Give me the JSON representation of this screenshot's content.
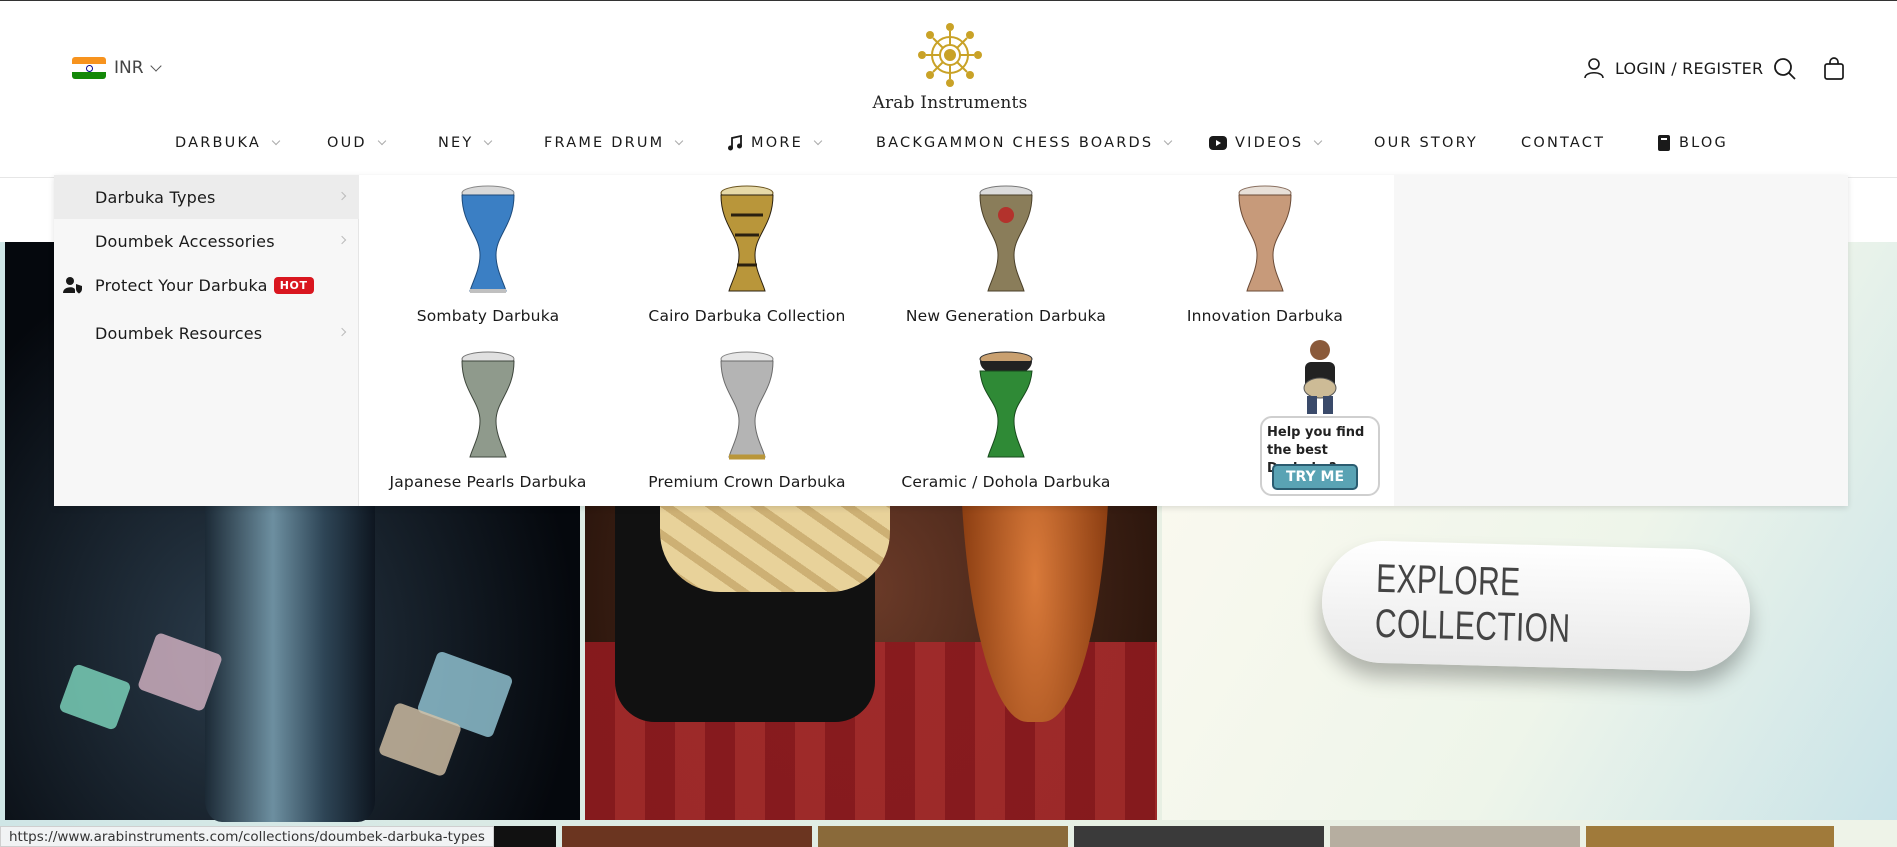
{
  "header": {
    "currency": {
      "code": "INR",
      "flag_icon": "india-flag-icon"
    },
    "logo": {
      "text": "Arab Instruments",
      "color": "#c9a227"
    },
    "account": {
      "label": "LOGIN / REGISTER",
      "icon": "user-icon"
    },
    "search_icon": "search-icon",
    "cart_icon": "shopping-bag-icon"
  },
  "nav": {
    "items": [
      {
        "label": "DARBUKA",
        "has_dropdown": true
      },
      {
        "label": "OUD",
        "has_dropdown": true
      },
      {
        "label": "NEY",
        "has_dropdown": true
      },
      {
        "label": "FRAME DRUM",
        "has_dropdown": true
      },
      {
        "label": "MORE",
        "has_dropdown": true,
        "icon": "music-note-icon"
      },
      {
        "label": "BACKGAMMON CHESS BOARDS",
        "has_dropdown": true
      },
      {
        "label": "VIDEOS",
        "has_dropdown": true,
        "icon": "youtube-icon"
      },
      {
        "label": "OUR STORY",
        "has_dropdown": false
      },
      {
        "label": "CONTACT",
        "has_dropdown": false
      },
      {
        "label": "BLOG",
        "has_dropdown": false,
        "icon": "book-icon"
      }
    ]
  },
  "mega_menu": {
    "side_items": [
      {
        "label": "Darbuka Types",
        "active": true
      },
      {
        "label": "Doumbek Accessories"
      },
      {
        "label": "Protect Your Darbuka",
        "badge": "HOT",
        "icon": "user-shield-icon"
      },
      {
        "label": "Doumbek Resources"
      }
    ],
    "products": [
      {
        "label": "Sombaty Darbuka",
        "color": "#3b7fc4"
      },
      {
        "label": "Cairo Darbuka Collection",
        "color": "#b9963a"
      },
      {
        "label": "New Generation Darbuka",
        "color": "#8a7d5a"
      },
      {
        "label": "Innovation Darbuka",
        "color": "#c79a7a"
      },
      {
        "label": "Japanese Pearls Darbuka",
        "color": "#8f9a8c"
      },
      {
        "label": "Premium Crown Darbuka",
        "color": "#b4b4b4"
      },
      {
        "label": "Ceramic / Dohola Darbuka",
        "color": "#2f8a36"
      }
    ],
    "helper": {
      "bubble_text": "Help you find the best Darbuka?",
      "button_label": "TRY ME"
    }
  },
  "hero": {
    "cta_label": "EXPLORE COLLECTION"
  },
  "status_bar": {
    "url": "https://www.arabinstruments.com/collections/doumbek-darbuka-types"
  }
}
